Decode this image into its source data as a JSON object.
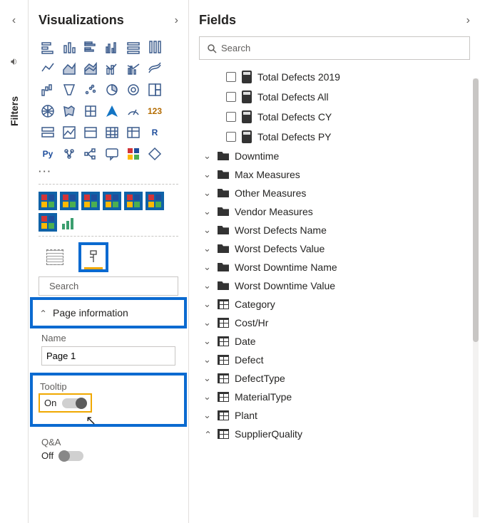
{
  "rail": {
    "filters_label": "Filters"
  },
  "visualizations": {
    "title": "Visualizations",
    "more_dots": "···",
    "search_placeholder": "Search",
    "page_info_label": "Page information",
    "name_label": "Name",
    "name_value": "Page 1",
    "tooltip_label": "Tooltip",
    "tooltip_state": "On",
    "qa_label": "Q&A",
    "qa_state": "Off",
    "r_label": "R",
    "py_label": "Py",
    "num_label": "123"
  },
  "fields": {
    "title": "Fields",
    "search_placeholder": "Search",
    "measures": [
      "Total Defects 2019",
      "Total Defects All",
      "Total Defects CY",
      "Total Defects PY"
    ],
    "folders": [
      "Downtime",
      "Max Measures",
      "Other Measures",
      "Vendor Measures",
      "Worst Defects Name",
      "Worst Defects Value",
      "Worst Downtime Name",
      "Worst Downtime Value"
    ],
    "tables": [
      "Category",
      "Cost/Hr",
      "Date",
      "Defect",
      "DefectType",
      "MaterialType",
      "Plant",
      "SupplierQuality"
    ]
  }
}
